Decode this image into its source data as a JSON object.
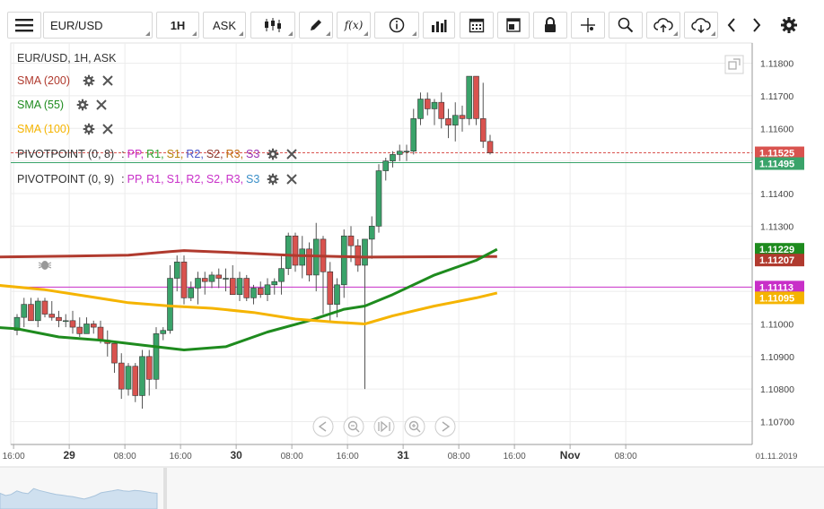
{
  "toolbar": {
    "symbol": "EUR/USD",
    "interval": "1H",
    "price_side": "ASK",
    "fx_label": "f(x)"
  },
  "legend": {
    "title": "EUR/USD, 1H, ASK",
    "sma": [
      {
        "label": "SMA (200)",
        "color": "#b03a2e"
      },
      {
        "label": "SMA (55)",
        "color": "#1e8b1e"
      },
      {
        "label": "SMA (100)",
        "color": "#f5b400"
      }
    ],
    "pivots": [
      {
        "label": "PIVOTPOINT (0, 8)",
        "sep": ":",
        "items": [
          {
            "t": "PP,",
            "c": "#c82fc8"
          },
          {
            "t": "R1,",
            "c": "#2ca02c"
          },
          {
            "t": "S1,",
            "c": "#b8860b"
          },
          {
            "t": "R2,",
            "c": "#4a54c8"
          },
          {
            "t": "S2,",
            "c": "#8b3a2e"
          },
          {
            "t": "R3,",
            "c": "#c06d0f"
          },
          {
            "t": "S3",
            "c": "#9a2eb0"
          }
        ]
      },
      {
        "label": "PIVOTPOINT (0, 9)",
        "sep": ":",
        "items": [
          {
            "t": "PP,",
            "c": "#c82fc8"
          },
          {
            "t": "R1,",
            "c": "#c82fc8"
          },
          {
            "t": "S1,",
            "c": "#c82fc8"
          },
          {
            "t": "R2,",
            "c": "#c82fc8"
          },
          {
            "t": "S2,",
            "c": "#c82fc8"
          },
          {
            "t": "R3,",
            "c": "#c82fc8"
          },
          {
            "t": "S3",
            "c": "#3a8fc8"
          }
        ]
      }
    ]
  },
  "price_badges": [
    {
      "text": "1.11525",
      "value": 1.11525,
      "color": "#d9534f"
    },
    {
      "text": "1.11495",
      "value": 1.11495,
      "color": "#3aa36a"
    },
    {
      "text": "1.11229",
      "value": 1.11229,
      "color": "#1e8b1e"
    },
    {
      "text": "1.11207",
      "value": 1.11207,
      "color": "#b03a2e"
    },
    {
      "text": "1.11113",
      "value": 1.11113,
      "color": "#c82fc8"
    },
    {
      "text": "1.11095",
      "value": 1.11095,
      "color": "#f5b400"
    }
  ],
  "chart_data": {
    "type": "candlestick",
    "ylim": [
      1.1063,
      1.1184
    ],
    "y_ticks": [
      1.107,
      1.108,
      1.109,
      1.11,
      1.111,
      1.112,
      1.113,
      1.114,
      1.115,
      1.116,
      1.117,
      1.118
    ],
    "y_tick_labels": [
      "1.10700",
      "1.10800",
      "1.10900",
      "1.11000",
      "1.11100",
      "1.11200",
      "1.11300",
      "1.11400",
      "1.11500",
      "1.11600",
      "1.11700",
      "1.11800"
    ],
    "x_labels": [
      {
        "i": -0.5,
        "t": "16:00",
        "bold": false
      },
      {
        "i": 7.5,
        "t": "29",
        "bold": true
      },
      {
        "i": 15.5,
        "t": "08:00",
        "bold": false
      },
      {
        "i": 23.5,
        "t": "16:00",
        "bold": false
      },
      {
        "i": 31.5,
        "t": "30",
        "bold": true
      },
      {
        "i": 39.5,
        "t": "08:00",
        "bold": false
      },
      {
        "i": 47.5,
        "t": "16:00",
        "bold": false
      },
      {
        "i": 55.5,
        "t": "31",
        "bold": true
      },
      {
        "i": 63.5,
        "t": "08:00",
        "bold": false
      },
      {
        "i": 71.5,
        "t": "16:00",
        "bold": false
      },
      {
        "i": 79.5,
        "t": "Nov",
        "bold": true
      },
      {
        "i": 87.5,
        "t": "08:00",
        "bold": false
      }
    ],
    "date_label": "01.11.2019",
    "candles": [
      {
        "o": 1.1098,
        "h": 1.1103,
        "l": 1.10965,
        "c": 1.1102
      },
      {
        "o": 1.1102,
        "h": 1.1108,
        "l": 1.1099,
        "c": 1.1106
      },
      {
        "o": 1.1106,
        "h": 1.1108,
        "l": 1.1101,
        "c": 1.1101
      },
      {
        "o": 1.1101,
        "h": 1.1108,
        "l": 1.1099,
        "c": 1.1107
      },
      {
        "o": 1.1107,
        "h": 1.1108,
        "l": 1.1102,
        "c": 1.1103
      },
      {
        "o": 1.1103,
        "h": 1.1107,
        "l": 1.1101,
        "c": 1.1102
      },
      {
        "o": 1.1102,
        "h": 1.1104,
        "l": 1.1099,
        "c": 1.1101
      },
      {
        "o": 1.1101,
        "h": 1.1103,
        "l": 1.1099,
        "c": 1.1101
      },
      {
        "o": 1.1101,
        "h": 1.1104,
        "l": 1.1097,
        "c": 1.1099
      },
      {
        "o": 1.1099,
        "h": 1.1102,
        "l": 1.1096,
        "c": 1.1097
      },
      {
        "o": 1.1097,
        "h": 1.1102,
        "l": 1.1097,
        "c": 1.11
      },
      {
        "o": 1.11,
        "h": 1.1101,
        "l": 1.1097,
        "c": 1.1099
      },
      {
        "o": 1.1099,
        "h": 1.1101,
        "l": 1.1094,
        "c": 1.1095
      },
      {
        "o": 1.1095,
        "h": 1.1098,
        "l": 1.109,
        "c": 1.1094
      },
      {
        "o": 1.1094,
        "h": 1.1094,
        "l": 1.1085,
        "c": 1.1088
      },
      {
        "o": 1.1088,
        "h": 1.1091,
        "l": 1.1077,
        "c": 1.108
      },
      {
        "o": 1.108,
        "h": 1.1088,
        "l": 1.1078,
        "c": 1.1087
      },
      {
        "o": 1.1087,
        "h": 1.1088,
        "l": 1.1076,
        "c": 1.1078
      },
      {
        "o": 1.1078,
        "h": 1.1092,
        "l": 1.1074,
        "c": 1.109
      },
      {
        "o": 1.109,
        "h": 1.1092,
        "l": 1.1078,
        "c": 1.1083
      },
      {
        "o": 1.1083,
        "h": 1.1099,
        "l": 1.108,
        "c": 1.1097
      },
      {
        "o": 1.1097,
        "h": 1.1099,
        "l": 1.1095,
        "c": 1.1098
      },
      {
        "o": 1.1098,
        "h": 1.1118,
        "l": 1.1097,
        "c": 1.1114
      },
      {
        "o": 1.1114,
        "h": 1.1121,
        "l": 1.111,
        "c": 1.1119
      },
      {
        "o": 1.1119,
        "h": 1.1121,
        "l": 1.1106,
        "c": 1.1108
      },
      {
        "o": 1.1108,
        "h": 1.1113,
        "l": 1.1107,
        "c": 1.1111
      },
      {
        "o": 1.1111,
        "h": 1.1116,
        "l": 1.1106,
        "c": 1.1114
      },
      {
        "o": 1.1114,
        "h": 1.1116,
        "l": 1.1109,
        "c": 1.1113
      },
      {
        "o": 1.1113,
        "h": 1.1116,
        "l": 1.1111,
        "c": 1.1115
      },
      {
        "o": 1.1115,
        "h": 1.1117,
        "l": 1.1111,
        "c": 1.1114
      },
      {
        "o": 1.1114,
        "h": 1.1117,
        "l": 1.111,
        "c": 1.1114
      },
      {
        "o": 1.1114,
        "h": 1.1118,
        "l": 1.1109,
        "c": 1.1109
      },
      {
        "o": 1.1109,
        "h": 1.1116,
        "l": 1.1107,
        "c": 1.1114
      },
      {
        "o": 1.1114,
        "h": 1.1115,
        "l": 1.1107,
        "c": 1.1108
      },
      {
        "o": 1.1108,
        "h": 1.1112,
        "l": 1.1106,
        "c": 1.1111
      },
      {
        "o": 1.1111,
        "h": 1.1113,
        "l": 1.1108,
        "c": 1.1109
      },
      {
        "o": 1.1109,
        "h": 1.1114,
        "l": 1.1107,
        "c": 1.1112
      },
      {
        "o": 1.1112,
        "h": 1.1114,
        "l": 1.1109,
        "c": 1.1113
      },
      {
        "o": 1.1113,
        "h": 1.1121,
        "l": 1.1109,
        "c": 1.1117
      },
      {
        "o": 1.1117,
        "h": 1.1128,
        "l": 1.1115,
        "c": 1.1127
      },
      {
        "o": 1.1127,
        "h": 1.1128,
        "l": 1.1116,
        "c": 1.1118
      },
      {
        "o": 1.1118,
        "h": 1.1127,
        "l": 1.1114,
        "c": 1.1123
      },
      {
        "o": 1.1123,
        "h": 1.1125,
        "l": 1.1113,
        "c": 1.1115
      },
      {
        "o": 1.1115,
        "h": 1.1131,
        "l": 1.111,
        "c": 1.1126
      },
      {
        "o": 1.1126,
        "h": 1.1127,
        "l": 1.1103,
        "c": 1.1116
      },
      {
        "o": 1.1116,
        "h": 1.1119,
        "l": 1.1101,
        "c": 1.1106
      },
      {
        "o": 1.1106,
        "h": 1.1114,
        "l": 1.1102,
        "c": 1.1112
      },
      {
        "o": 1.1112,
        "h": 1.1129,
        "l": 1.1108,
        "c": 1.1127
      },
      {
        "o": 1.1127,
        "h": 1.113,
        "l": 1.1119,
        "c": 1.1124
      },
      {
        "o": 1.1124,
        "h": 1.1126,
        "l": 1.1116,
        "c": 1.1118
      },
      {
        "o": 1.1118,
        "h": 1.1126,
        "l": 1.108,
        "c": 1.1126
      },
      {
        "o": 1.1126,
        "h": 1.1133,
        "l": 1.112,
        "c": 1.113
      },
      {
        "o": 1.113,
        "h": 1.1149,
        "l": 1.1128,
        "c": 1.1147
      },
      {
        "o": 1.1147,
        "h": 1.1151,
        "l": 1.1144,
        "c": 1.115
      },
      {
        "o": 1.115,
        "h": 1.1153,
        "l": 1.1148,
        "c": 1.1152
      },
      {
        "o": 1.1152,
        "h": 1.1155,
        "l": 1.115,
        "c": 1.1153
      },
      {
        "o": 1.1153,
        "h": 1.1155,
        "l": 1.115,
        "c": 1.1153
      },
      {
        "o": 1.1153,
        "h": 1.1166,
        "l": 1.1152,
        "c": 1.1163
      },
      {
        "o": 1.1163,
        "h": 1.1171,
        "l": 1.1161,
        "c": 1.1169
      },
      {
        "o": 1.1169,
        "h": 1.1171,
        "l": 1.1164,
        "c": 1.1166
      },
      {
        "o": 1.1166,
        "h": 1.1169,
        "l": 1.1161,
        "c": 1.1168
      },
      {
        "o": 1.1168,
        "h": 1.1171,
        "l": 1.116,
        "c": 1.1163
      },
      {
        "o": 1.1163,
        "h": 1.1166,
        "l": 1.1157,
        "c": 1.1161
      },
      {
        "o": 1.1161,
        "h": 1.1168,
        "l": 1.1156,
        "c": 1.1164
      },
      {
        "o": 1.1164,
        "h": 1.1167,
        "l": 1.1159,
        "c": 1.1163
      },
      {
        "o": 1.1163,
        "h": 1.1176,
        "l": 1.1161,
        "c": 1.1176
      },
      {
        "o": 1.1176,
        "h": 1.1176,
        "l": 1.1161,
        "c": 1.1163
      },
      {
        "o": 1.1163,
        "h": 1.1174,
        "l": 1.1154,
        "c": 1.1156
      },
      {
        "o": 1.1156,
        "h": 1.1158,
        "l": 1.1152,
        "c": 1.11525
      }
    ],
    "series": [
      {
        "name": "SMA (200)",
        "color": "#b03a2e",
        "points": [
          [
            -3.5,
            1.11205
          ],
          [
            8,
            1.11208
          ],
          [
            16,
            1.11211
          ],
          [
            22,
            1.11222
          ],
          [
            24,
            1.11225
          ],
          [
            30,
            1.1122
          ],
          [
            40,
            1.1121
          ],
          [
            50,
            1.11205
          ],
          [
            60,
            1.11206
          ],
          [
            69,
            1.11207
          ]
        ]
      },
      {
        "name": "SMA (55)",
        "color": "#1e8b1e",
        "points": [
          [
            -3.5,
            1.1099
          ],
          [
            0,
            1.10985
          ],
          [
            6,
            1.1096
          ],
          [
            12,
            1.1095
          ],
          [
            18,
            1.10935
          ],
          [
            24,
            1.1092
          ],
          [
            30,
            1.1093
          ],
          [
            36,
            1.10975
          ],
          [
            42,
            1.1101
          ],
          [
            47,
            1.11045
          ],
          [
            50,
            1.11055
          ],
          [
            54,
            1.1109
          ],
          [
            60,
            1.1115
          ],
          [
            66,
            1.11195
          ],
          [
            69,
            1.11229
          ]
        ]
      },
      {
        "name": "SMA (100)",
        "color": "#f5b400",
        "points": [
          [
            -3.5,
            1.1112
          ],
          [
            4,
            1.11105
          ],
          [
            10,
            1.11085
          ],
          [
            16,
            1.11065
          ],
          [
            22,
            1.11055
          ],
          [
            28,
            1.11048
          ],
          [
            34,
            1.11035
          ],
          [
            40,
            1.11015
          ],
          [
            46,
            1.11005
          ],
          [
            50,
            1.11,
            0
          ],
          [
            54,
            1.11025
          ],
          [
            60,
            1.11055
          ],
          [
            66,
            1.1108
          ],
          [
            69,
            1.11095
          ]
        ]
      }
    ],
    "pivot_lines": [
      {
        "value": 1.11525,
        "color": "#d9534f",
        "dash": true
      },
      {
        "value": 1.11495,
        "color": "#3aa36a",
        "dash": false
      },
      {
        "value": 1.11113,
        "color": "#c82fc8",
        "dash": false
      }
    ],
    "navigator": [
      0.6,
      0.5,
      0.55,
      0.7,
      0.62,
      0.58,
      0.8,
      0.72,
      0.66,
      0.6,
      0.55,
      0.52,
      0.48,
      0.45,
      0.4,
      0.35,
      0.42,
      0.5,
      0.62,
      0.66,
      0.7,
      0.75,
      0.7,
      0.68,
      0.72,
      0.7,
      0.66,
      0.62,
      0.6
    ]
  },
  "colors": {
    "up": "#3aa36a",
    "down": "#d9534f",
    "grid": "#ececec",
    "axis": "#888"
  }
}
